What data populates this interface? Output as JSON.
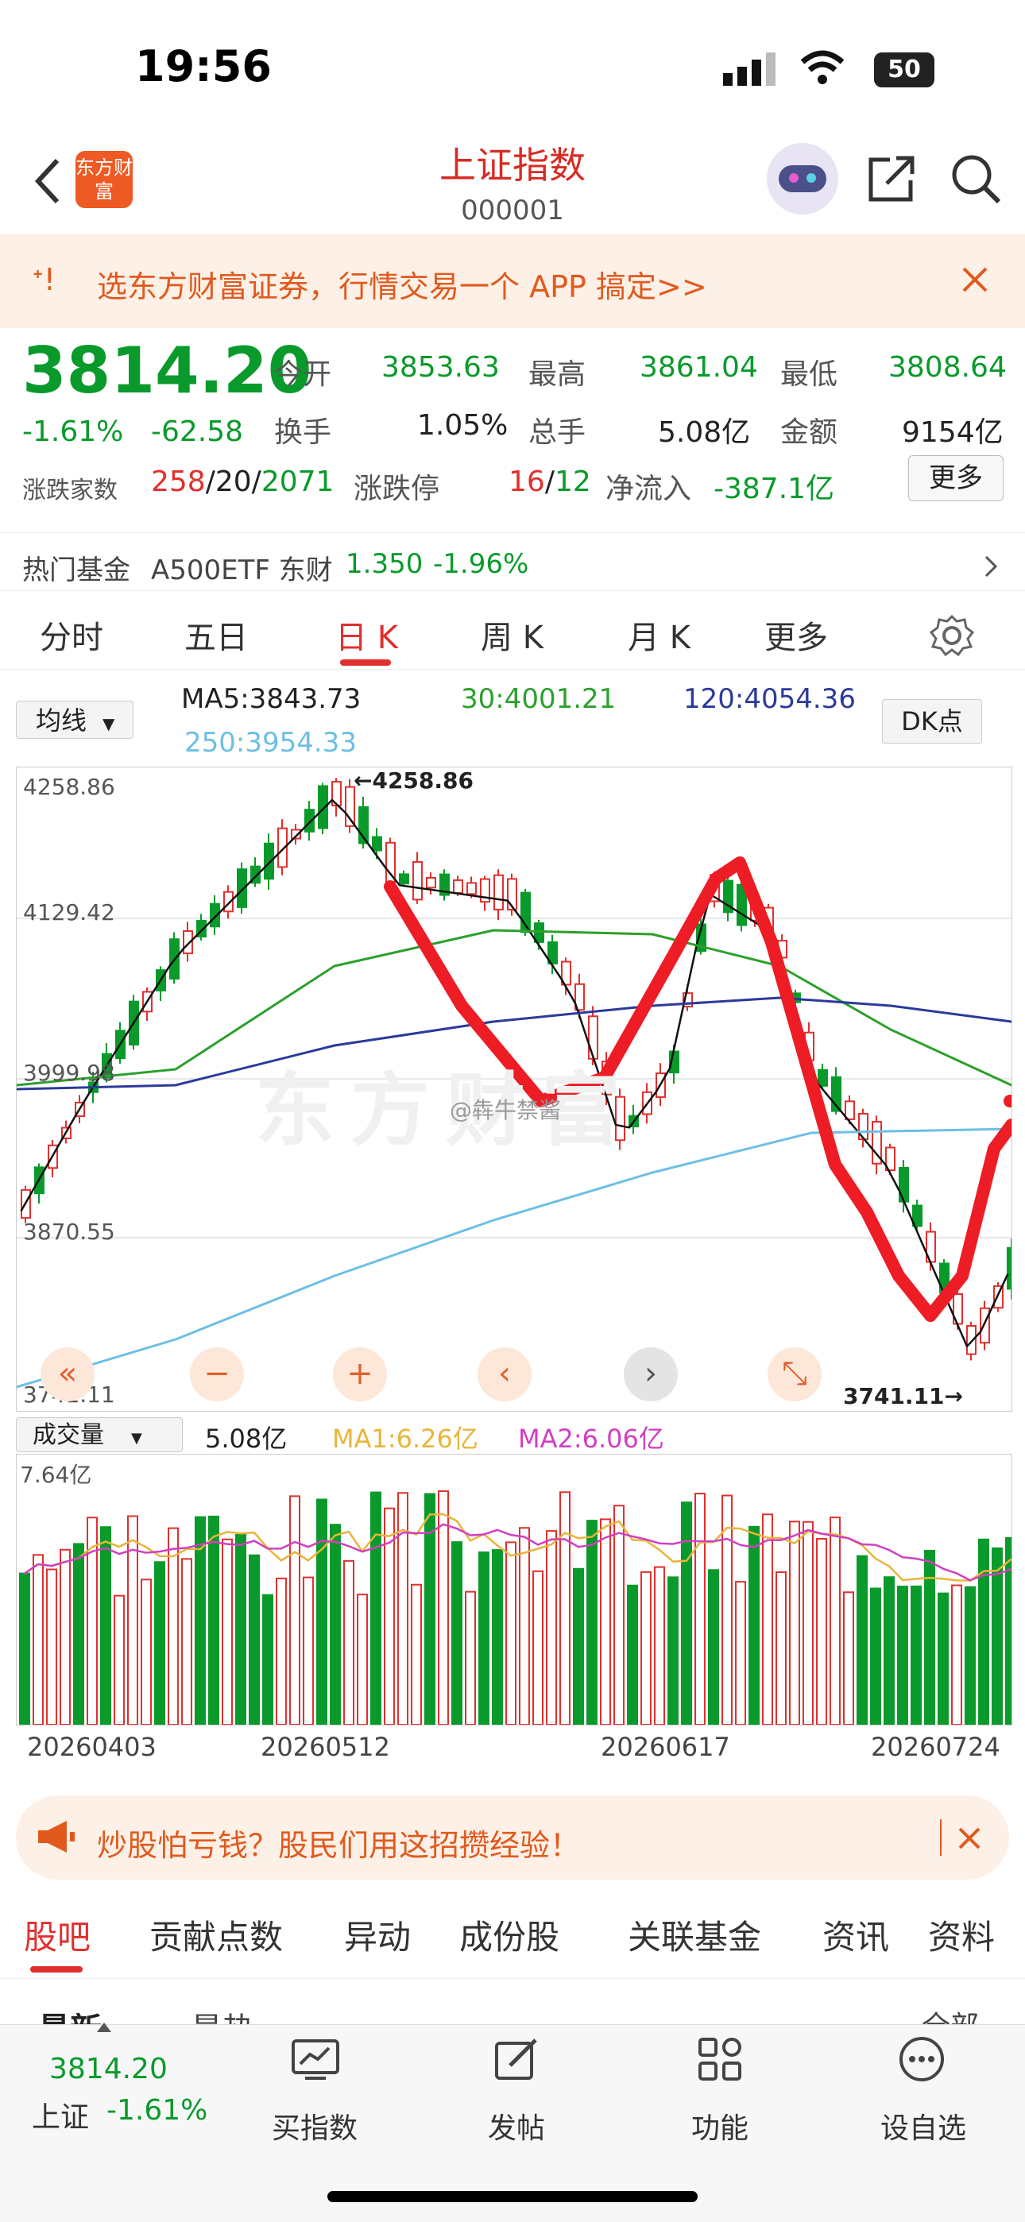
{
  "status_bar": {
    "time": "19:56",
    "battery": "50"
  },
  "header": {
    "title": "上证指数",
    "code": "000001",
    "logo_text": "东方财富"
  },
  "banner": {
    "text": "选东方财富证券，行情交易一个 APP 搞定>>"
  },
  "quote": {
    "price": "3814.20",
    "change_pct": "-1.61%",
    "change": "-62.58",
    "open_label": "今开",
    "open": "3853.63",
    "high_label": "最高",
    "high": "3861.04",
    "low_label": "最低",
    "low": "3808.64",
    "turnover_label": "换手",
    "turnover": "1.05%",
    "volume_label": "总手",
    "volume": "5.08亿",
    "amount_label": "金额",
    "amount": "9154亿",
    "breadth_label": "涨跌家数",
    "up_count": "258",
    "flat_count": "20",
    "down_count": "2071",
    "limit_label": "涨跌停",
    "limit_up": "16",
    "limit_down": "12",
    "netflow_label": "净流入",
    "netflow": "-387.1亿",
    "more_button": "更多"
  },
  "hot_fund": {
    "label": "热门基金",
    "name": "A500ETF 东财",
    "price": "1.350",
    "change": "-1.96%"
  },
  "tabs": [
    "分时",
    "五日",
    "日 K",
    "周 K",
    "月 K",
    "更多"
  ],
  "ma_bar": {
    "selector": "均线",
    "ma5": "MA5:3843.73",
    "ma30": "30:4001.21",
    "ma120": "120:4054.36",
    "ma250": "250:3954.33",
    "dk_button": "DK点"
  },
  "chart_labels": {
    "y1": "4258.86",
    "y2": "4129.42",
    "y3": "3999.98",
    "y4": "3870.55",
    "y5": "3741.11",
    "high_marker": "←4258.86",
    "low_marker": "3741.11→",
    "watermark": "东方财富",
    "weibo": "@犇牛禁酱"
  },
  "chart_controls": [
    "«",
    "−",
    "+",
    "‹",
    "›",
    "⤡"
  ],
  "volume": {
    "selector": "成交量",
    "value": "5.08亿",
    "ma1": "MA1:6.26亿",
    "ma2": "MA2:6.06亿",
    "max_label": "7.64亿"
  },
  "dates": [
    "20260403",
    "20260512",
    "20260617",
    "20260724"
  ],
  "promo": {
    "text": "炒股怕亏钱？股民们用这招攒经验！"
  },
  "bottom_tabs": [
    "股吧",
    "贡献点数",
    "异动",
    "成份股",
    "关联基金",
    "资讯",
    "资料"
  ],
  "sub_tabs": [
    "最新",
    "最热",
    "全部"
  ],
  "dock": {
    "index_price": "3814.20",
    "index_name": "上证",
    "index_change": "-1.61%",
    "items": [
      "买指数",
      "发帖",
      "功能",
      "设自选"
    ]
  },
  "colors": {
    "up": "#e0302d",
    "down": "#0a9a2b",
    "accent": "#e0302d",
    "banner_bg": "#fdf0e6"
  }
}
